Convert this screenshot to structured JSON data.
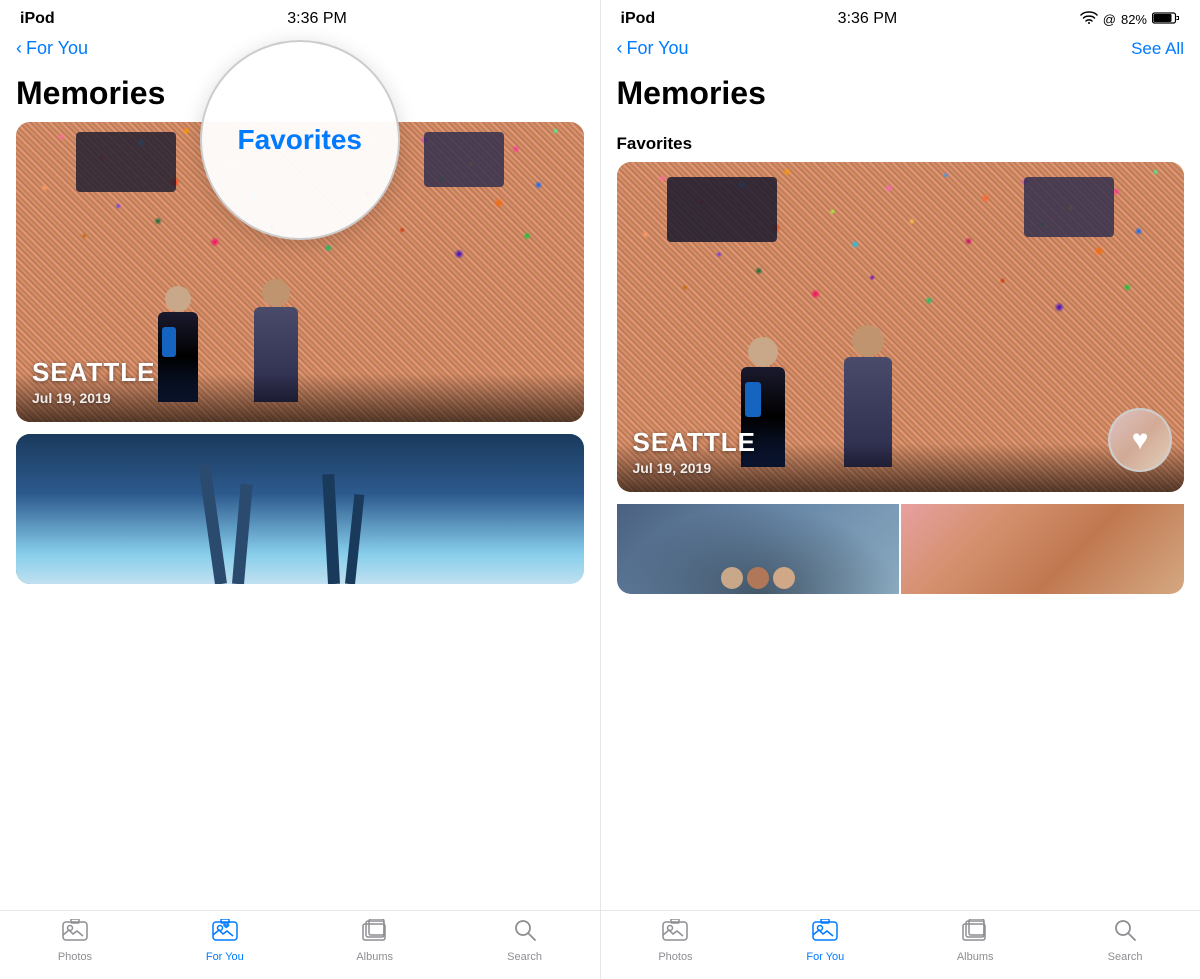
{
  "screens": [
    {
      "id": "left-screen",
      "status_bar": {
        "left": "iPod",
        "center": "3:36 PM",
        "right": ""
      },
      "nav": {
        "back_label": "For You",
        "title": "",
        "action": ""
      },
      "page_title": "Memories",
      "circle_overlay": {
        "visible": true,
        "text": "Favorites"
      },
      "memories": [
        {
          "location": "SEATTLE",
          "date": "Jul 19, 2019",
          "type": "gum-wall"
        },
        {
          "type": "artwork"
        }
      ],
      "tab_bar": {
        "items": [
          {
            "id": "photos",
            "icon": "🖼",
            "label": "Photos",
            "active": false
          },
          {
            "id": "for-you",
            "icon": "♥",
            "label": "For You",
            "active": true
          },
          {
            "id": "albums",
            "icon": "📁",
            "label": "Albums",
            "active": false
          },
          {
            "id": "search",
            "icon": "🔍",
            "label": "Search",
            "active": false
          }
        ]
      }
    },
    {
      "id": "right-screen",
      "status_bar": {
        "left": "iPod",
        "center": "3:36 PM",
        "right": "82%"
      },
      "nav": {
        "back_label": "For You",
        "title": "",
        "action": "See All"
      },
      "page_title": "Memories",
      "section_label": "Favorites",
      "heart_overlay": {
        "visible": true
      },
      "memories": [
        {
          "location": "SEATTLE",
          "date": "Jul 19, 2019",
          "type": "gum-wall"
        }
      ],
      "thumbnail_row": {
        "visible": true
      },
      "tab_bar": {
        "items": [
          {
            "id": "photos",
            "icon": "🖼",
            "label": "Photos",
            "active": false
          },
          {
            "id": "for-you",
            "icon": "♥",
            "label": "For You",
            "active": true
          },
          {
            "id": "albums",
            "icon": "📁",
            "label": "Albums",
            "active": false
          },
          {
            "id": "search",
            "icon": "🔍",
            "label": "Search",
            "active": false
          }
        ]
      }
    }
  ],
  "colors": {
    "accent": "#007aff",
    "active_tab": "#007aff",
    "inactive_tab": "#8e8e93",
    "text_primary": "#000000",
    "bg": "#ffffff"
  }
}
